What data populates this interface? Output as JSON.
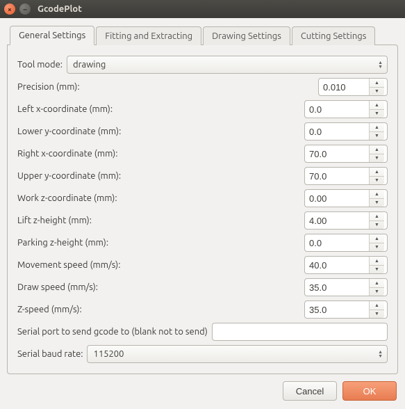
{
  "window": {
    "title": "GcodePlot"
  },
  "tabs": [
    {
      "label": "General Settings"
    },
    {
      "label": "Fitting and Extracting"
    },
    {
      "label": "Drawing Settings"
    },
    {
      "label": "Cutting Settings"
    }
  ],
  "fields": {
    "tool_mode": {
      "label": "Tool mode:",
      "value": "drawing"
    },
    "precision": {
      "label": "Precision (mm):",
      "value": "0.010"
    },
    "left_x": {
      "label": "Left x-coordinate (mm):",
      "value": "0.0"
    },
    "lower_y": {
      "label": "Lower y-coordinate (mm):",
      "value": "0.0"
    },
    "right_x": {
      "label": "Right x-coordinate (mm):",
      "value": "70.0"
    },
    "upper_y": {
      "label": "Upper y-coordinate (mm):",
      "value": "70.0"
    },
    "work_z": {
      "label": "Work z-coordinate (mm):",
      "value": "0.00"
    },
    "lift_z": {
      "label": "Lift z-height (mm):",
      "value": "4.00"
    },
    "parking_z": {
      "label": "Parking z-height (mm):",
      "value": "0.0"
    },
    "move_speed": {
      "label": "Movement speed (mm/s):",
      "value": "40.0"
    },
    "draw_speed": {
      "label": "Draw speed (mm/s):",
      "value": "35.0"
    },
    "z_speed": {
      "label": "Z-speed (mm/s):",
      "value": "35.0"
    },
    "serial_port": {
      "label": "Serial port to send gcode to (blank not to send)",
      "value": ""
    },
    "baud_rate": {
      "label": "Serial baud rate:",
      "value": "115200"
    }
  },
  "buttons": {
    "cancel": "Cancel",
    "ok": "OK"
  }
}
